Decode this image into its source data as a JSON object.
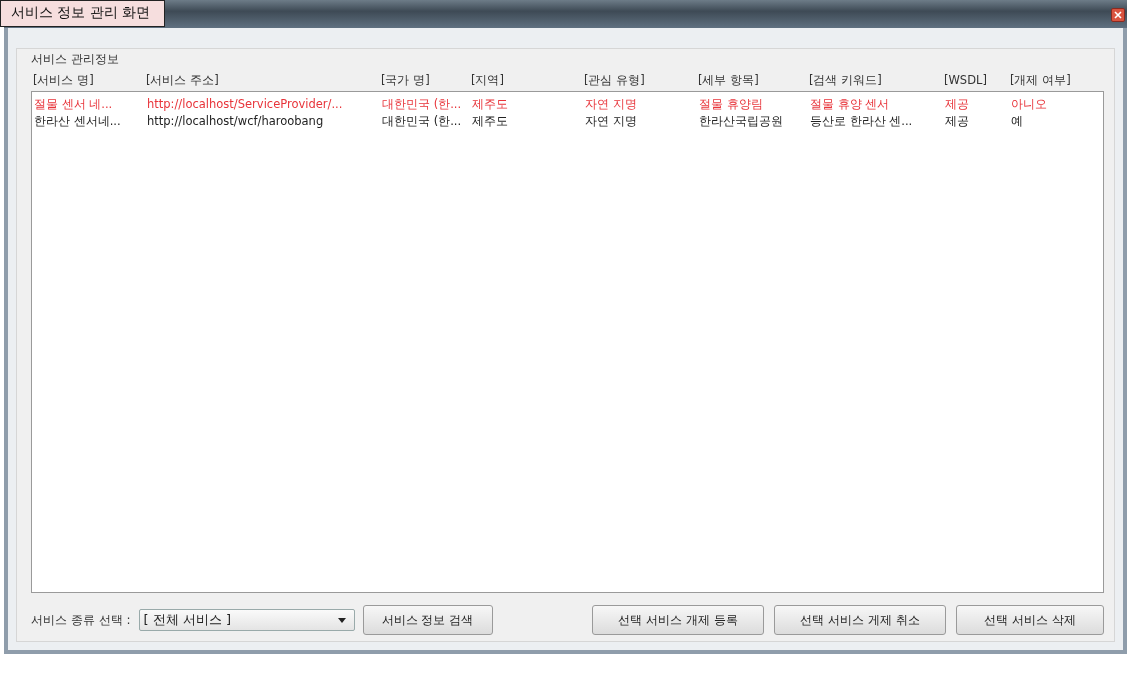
{
  "window": {
    "title": "서비스 정보 관리 화면"
  },
  "group": {
    "title": "서비스 관리정보"
  },
  "table": {
    "columns": [
      "[서비스 명]",
      "[서비스 주소]",
      "[국가 명]",
      "[지역]",
      "[관심 유형]",
      "[세부 항목]",
      "[검색 키워드]",
      "[WSDL]",
      "[개제 여부]"
    ],
    "rows": [
      {
        "color": "#e8343a",
        "cells": [
          "절물 센서 네...",
          "http://localhost/ServiceProvider/...",
          "대한민국 (한...",
          "제주도",
          "자연 지명",
          "절물 휴양림",
          "절물 휴양 센서",
          "제공",
          "아니오"
        ]
      },
      {
        "color": "#222222",
        "cells": [
          "한라산 센서네...",
          "http://localhost/wcf/haroobang",
          "대한민국 (한...",
          "제주도",
          "자연 지명",
          "한라산국립공원",
          "등산로 한라산 센...",
          "제공",
          "예"
        ]
      }
    ]
  },
  "filter": {
    "label": "서비스 종류 선택 :",
    "value": "[ 전체 서비스 ]"
  },
  "buttons": {
    "search": "서비스 정보 검색",
    "actions": [
      "선택 서비스 개제 등록",
      "선택 서비스 게제 취소",
      "선택 서비스 삭제"
    ]
  }
}
